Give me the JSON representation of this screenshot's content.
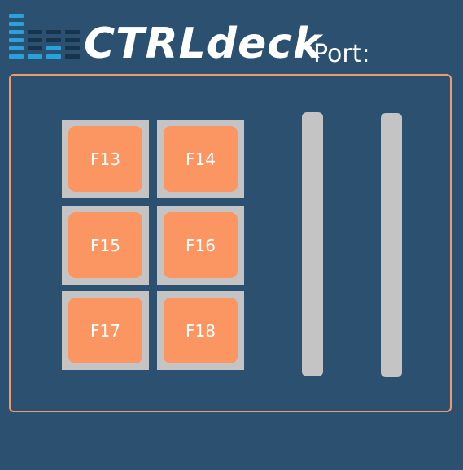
{
  "app": {
    "brand_name": "CTRLdeck",
    "port_label": "Port:"
  },
  "colors": {
    "background": "#2c5170",
    "accent": "#ef9a6c",
    "key_face": "#fb9561",
    "key_frame": "#c4c4c4",
    "logo_bar_lit": "#27a2dc",
    "logo_bar_dim": "#17344f"
  },
  "logo": {
    "icon": "level-meter-icon",
    "columns": [
      {
        "lit": 6,
        "total": 6
      },
      {
        "lit": 1,
        "total": 4
      },
      {
        "lit": 2,
        "total": 4
      },
      {
        "lit": 0,
        "total": 4
      }
    ]
  },
  "keys": [
    {
      "label": "F13"
    },
    {
      "label": "F14"
    },
    {
      "label": "F15"
    },
    {
      "label": "F16"
    },
    {
      "label": "F17"
    },
    {
      "label": "F18"
    }
  ],
  "sliders": [
    {
      "name": "slider-1"
    },
    {
      "name": "slider-2"
    }
  ]
}
